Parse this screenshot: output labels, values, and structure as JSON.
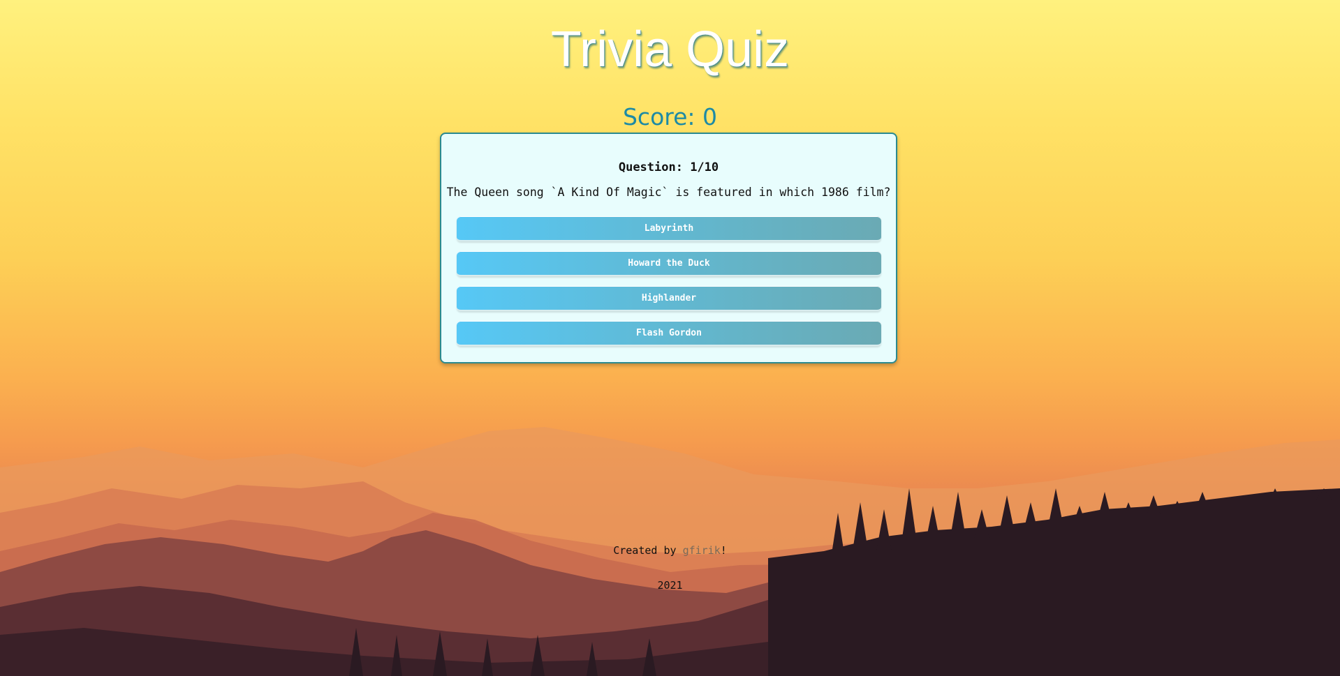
{
  "app": {
    "title": "Trivia Quiz"
  },
  "score": {
    "label": "Score: 0"
  },
  "quiz": {
    "counter": "Question: 1/10",
    "question": "The Queen song `A Kind Of Magic` is featured in which 1986 film?",
    "answers": [
      {
        "label": "Labyrinth"
      },
      {
        "label": "Howard the Duck"
      },
      {
        "label": "Highlander"
      },
      {
        "label": "Flash Gordon"
      }
    ]
  },
  "footer": {
    "created_prefix": "Created by ",
    "author": "gfirik",
    "created_suffix": "!",
    "year": "2021"
  },
  "colors": {
    "accent": "#1d8aa5",
    "card_border": "#2b8a8f",
    "card_bg": "#e8fdfd",
    "button_start": "#56c8f6",
    "button_end": "#6aaab4"
  }
}
